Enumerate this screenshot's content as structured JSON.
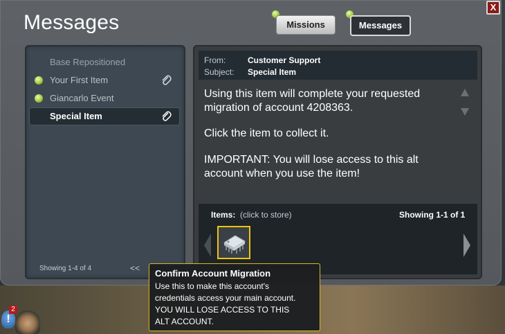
{
  "window": {
    "title": "Messages",
    "close_label": "X"
  },
  "tabs": [
    {
      "label": "Missions",
      "active": false
    },
    {
      "label": "Messages",
      "active": true
    }
  ],
  "message_list": {
    "items": [
      {
        "label": "Base Repositioned",
        "unread": false,
        "attachment": false,
        "selected": false
      },
      {
        "label": "Your First Item",
        "unread": true,
        "attachment": true,
        "selected": false
      },
      {
        "label": "Giancarlo Event",
        "unread": true,
        "attachment": false,
        "selected": false
      },
      {
        "label": "Special Item",
        "unread": false,
        "attachment": true,
        "selected": true
      }
    ],
    "showing": "Showing 1-4 of 4",
    "collapse_label": "<<"
  },
  "message": {
    "from_label": "From:",
    "from": "Customer Support",
    "subject_label": "Subject:",
    "subject": "Special Item",
    "body": [
      "Using this item will complete your requested",
      "migration of account 4208363.",
      "Click the item to collect it.",
      "IMPORTANT: You will lose access to this alt",
      "account when you use the item!"
    ]
  },
  "items_panel": {
    "label": "Items:",
    "hint": "(click to store)",
    "showing": "Showing 1-1 of 1",
    "items": [
      {
        "name": "chip-item",
        "icon": "microchip-icon"
      }
    ]
  },
  "tooltip": {
    "title": "Confirm Account Migration",
    "lines": [
      "Use this to make this account's",
      "credentials access your main account.",
      "YOU WILL LOSE ACCESS TO THIS",
      "ALT ACCOUNT."
    ]
  },
  "hud": {
    "alert_badge": "2",
    "alert_icon_glyph": "!"
  },
  "colors": {
    "unread_dot": "#9fc23a",
    "tooltip_border": "#d8b82a",
    "item_slot_border": "#f1c40f"
  }
}
